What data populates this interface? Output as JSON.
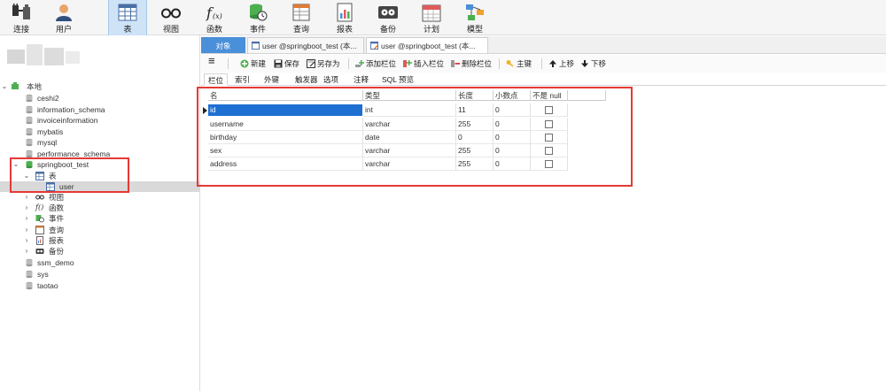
{
  "toolbar": {
    "buttons": [
      {
        "label": "连接",
        "icon": "plug-icon"
      },
      {
        "label": "用户",
        "icon": "user-icon"
      },
      {
        "label": "表",
        "icon": "table-icon"
      },
      {
        "label": "视图",
        "icon": "glasses-icon"
      },
      {
        "label": "函数",
        "icon": "function-icon"
      },
      {
        "label": "事件",
        "icon": "event-icon"
      },
      {
        "label": "查询",
        "icon": "query-icon"
      },
      {
        "label": "报表",
        "icon": "report-icon"
      },
      {
        "label": "备份",
        "icon": "backup-icon"
      },
      {
        "label": "计划",
        "icon": "calendar-icon"
      },
      {
        "label": "模型",
        "icon": "model-icon"
      }
    ],
    "active": "表"
  },
  "nav": {
    "connection": "本地",
    "items": [
      {
        "label": "ceshi2"
      },
      {
        "label": "information_schema"
      },
      {
        "label": "invoiceinformation"
      },
      {
        "label": "mybatis"
      },
      {
        "label": "mysql"
      },
      {
        "label": "performance_schema"
      },
      {
        "label": "springboot_test"
      },
      {
        "label": "表"
      },
      {
        "label": "user"
      },
      {
        "label": "视图"
      },
      {
        "label": "函数"
      },
      {
        "label": "事件"
      },
      {
        "label": "查询"
      },
      {
        "label": "报表"
      },
      {
        "label": "备份"
      },
      {
        "label": "ssm_demo"
      },
      {
        "label": "sys"
      },
      {
        "label": "taotao"
      }
    ],
    "fx_prefix": "f()"
  },
  "tabs": [
    {
      "label": "对象"
    },
    {
      "label": "user @springboot_test (本..."
    },
    {
      "label": "user @springboot_test (本..."
    }
  ],
  "designer_toolbar": {
    "menu_icon": "≡",
    "items": [
      {
        "label": "新建"
      },
      {
        "label": "保存"
      },
      {
        "label": "另存为"
      },
      {
        "label": "添加栏位"
      },
      {
        "label": "插入栏位"
      },
      {
        "label": "删除栏位"
      },
      {
        "label": "主键"
      },
      {
        "label": "上移"
      },
      {
        "label": "下移"
      }
    ]
  },
  "subtabs": [
    {
      "label": "栏位"
    },
    {
      "label": "索引"
    },
    {
      "label": "外键"
    },
    {
      "label": "触发器"
    },
    {
      "label": "选项"
    },
    {
      "label": "注释"
    },
    {
      "label": "SQL 预览"
    }
  ],
  "grid": {
    "headers": [
      "名",
      "类型",
      "长度",
      "小数点",
      "不是 null"
    ],
    "rows": [
      {
        "name": "id",
        "type": "int",
        "length": "11",
        "decimals": "0",
        "not_null": false
      },
      {
        "name": "username",
        "type": "varchar",
        "length": "255",
        "decimals": "0",
        "not_null": false
      },
      {
        "name": "birthday",
        "type": "date",
        "length": "0",
        "decimals": "0",
        "not_null": false
      },
      {
        "name": "sex",
        "type": "varchar",
        "length": "255",
        "decimals": "0",
        "not_null": false
      },
      {
        "name": "address",
        "type": "varchar",
        "length": "255",
        "decimals": "0",
        "not_null": false
      }
    ]
  },
  "colors": {
    "accent": "#4a8fd9",
    "highlight_box": "#e53935",
    "selection": "#1e6fd2"
  }
}
